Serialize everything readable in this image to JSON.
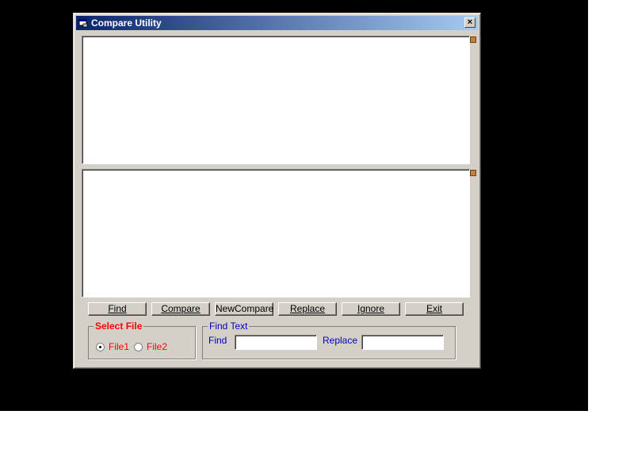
{
  "window": {
    "title": "Compare Utility",
    "close_glyph": "×"
  },
  "icons": {
    "app": "app-window-icon",
    "close": "close-icon"
  },
  "panes": {
    "file1_text": "",
    "file2_text": ""
  },
  "buttons": [
    {
      "label": "Find",
      "mnemonic": "F"
    },
    {
      "label": "Compare",
      "mnemonic": "C"
    },
    {
      "label": "NewCompare",
      "mnemonic": ""
    },
    {
      "label": "Replace",
      "mnemonic": "R"
    },
    {
      "label": "Ignore",
      "mnemonic": "I"
    },
    {
      "label": "Exit",
      "mnemonic": "E"
    }
  ],
  "select_file": {
    "legend": "Select File",
    "options": [
      {
        "label": "File1",
        "checked": true
      },
      {
        "label": "File2",
        "checked": false
      }
    ]
  },
  "find_text": {
    "legend": "Find Text",
    "find_label": "Find",
    "find_value": "",
    "replace_label": "Replace",
    "replace_value": ""
  },
  "colors": {
    "select_file": "#ff0000",
    "find_text": "#0000c0",
    "title_start": "#0a246a",
    "title_end": "#a6caf0"
  }
}
